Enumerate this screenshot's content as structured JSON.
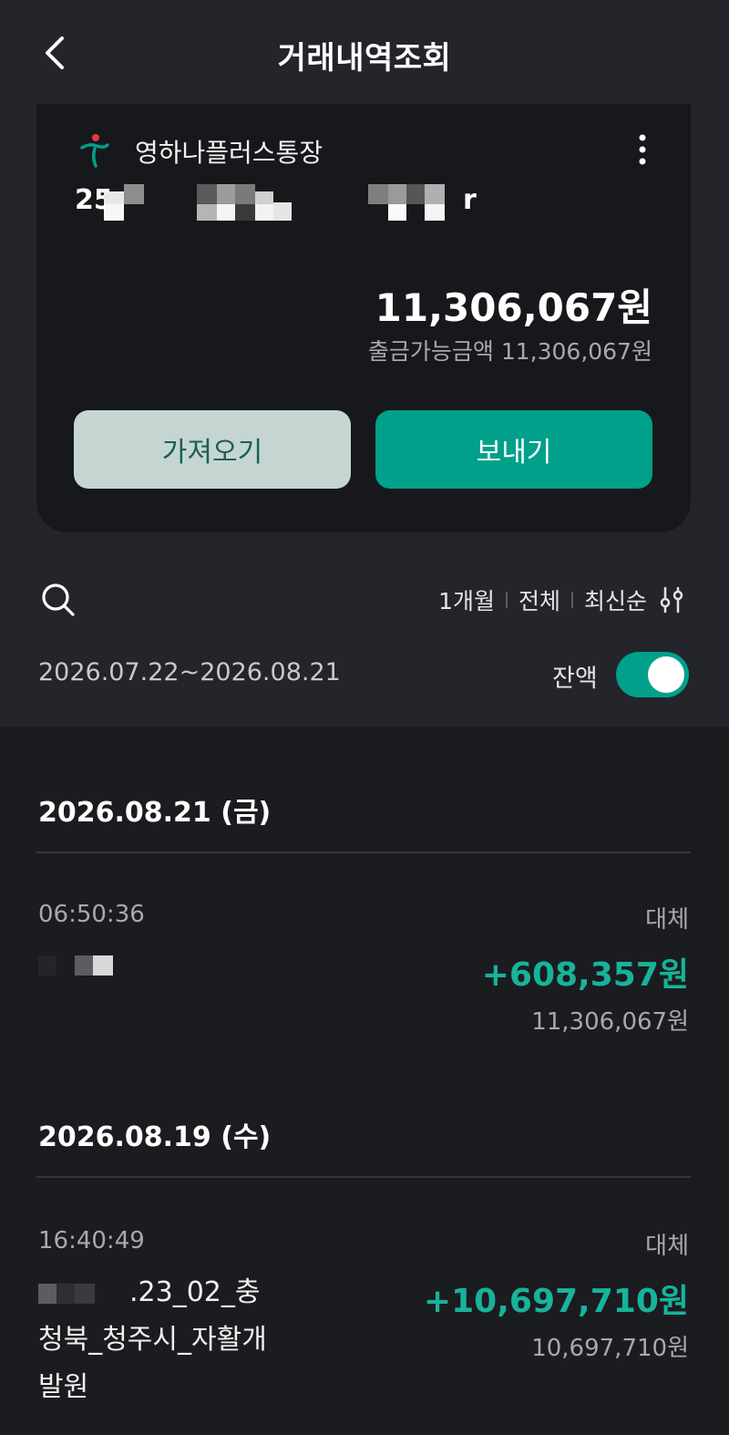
{
  "header": {
    "title": "거래내역조회"
  },
  "account": {
    "name": "영하나플러스통장",
    "number_prefix": "25",
    "number_suffix": "r",
    "balance": "11,306,067원",
    "available": "출금가능금액 11,306,067원",
    "brand_color": "#00a08a"
  },
  "buttons": {
    "bring": "가져오기",
    "send": "보내기"
  },
  "filters": {
    "period": "1개월",
    "scope": "전체",
    "order": "최신순"
  },
  "range": {
    "dates": "2026.07.22~2026.08.21",
    "balance_label": "잔액",
    "balance_toggle_on": true
  },
  "days": [
    {
      "date": "2026.08.21 (금)",
      "transactions": [
        {
          "time": "06:50:36",
          "type": "대체",
          "amount": "+608,357원",
          "balance_after": "11,306,067원"
        }
      ]
    },
    {
      "date": "2026.08.19 (수)",
      "transactions": [
        {
          "time": "16:40:49",
          "type": "대체",
          "desc_line1": ".23_02_충",
          "desc_line2": "청북_청주시_자활개",
          "desc_line3": "발원",
          "amount": "+10,697,710원",
          "balance_after": "10,697,710원"
        }
      ]
    }
  ]
}
